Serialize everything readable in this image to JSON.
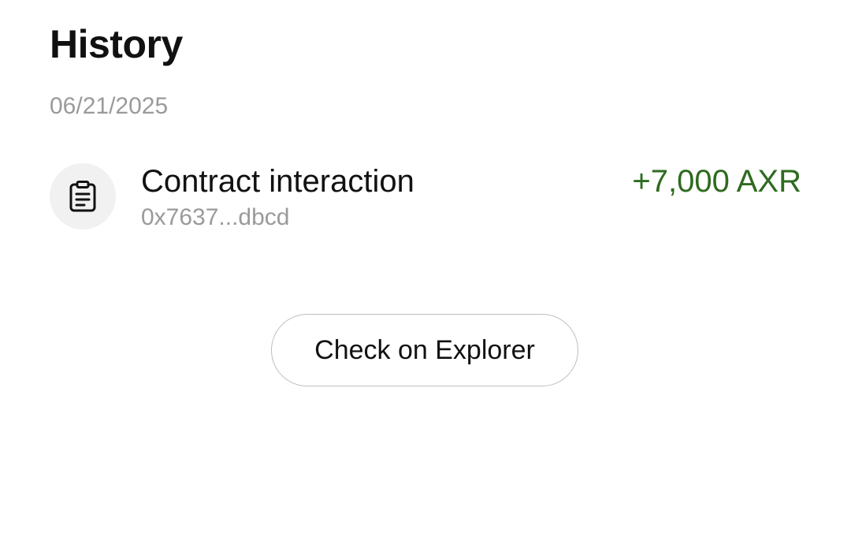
{
  "header": {
    "title": "History"
  },
  "history": {
    "groups": [
      {
        "date": "06/21/2025",
        "transactions": [
          {
            "icon": "clipboard-icon",
            "title": "Contract interaction",
            "address": "0x7637...dbcd",
            "amount": "+7,000 AXR",
            "amount_color": "#2e6b1f"
          }
        ]
      }
    ]
  },
  "actions": {
    "explorer_label": "Check on Explorer"
  }
}
